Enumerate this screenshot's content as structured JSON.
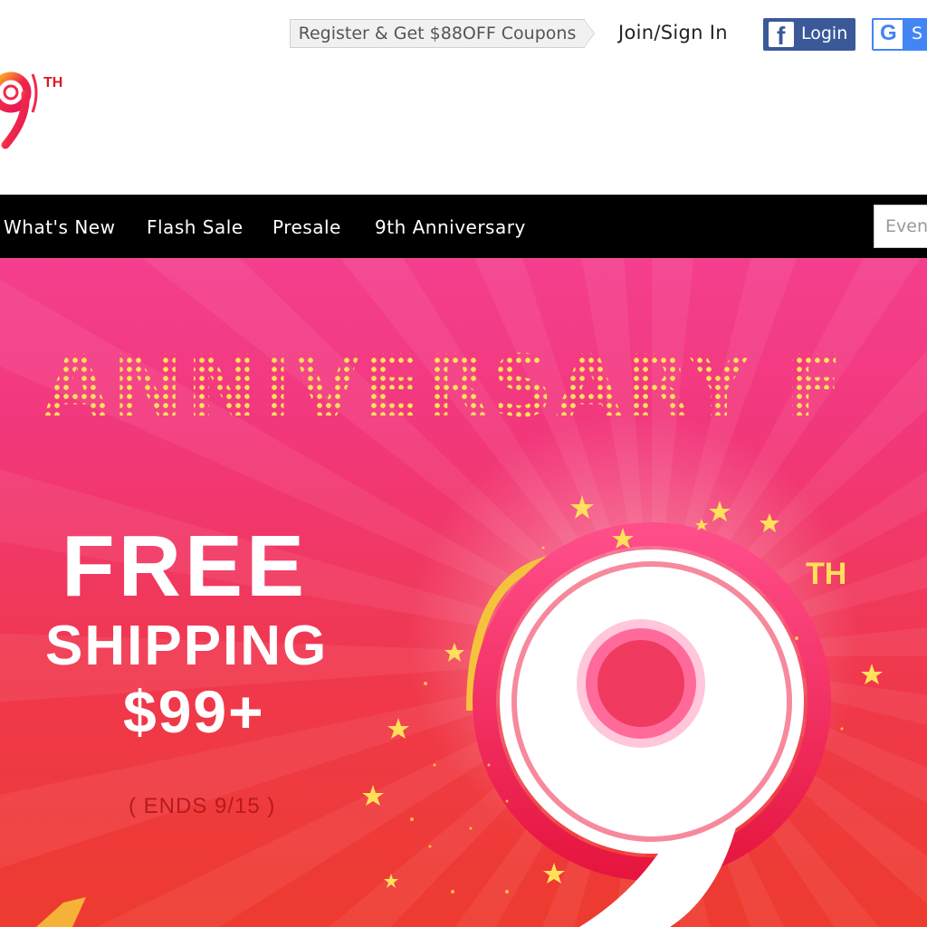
{
  "topbar": {
    "coupon_text": "Register & Get $88OFF Coupons",
    "join_text": "Join/Sign In",
    "facebook_label": "Login",
    "google_label": "S"
  },
  "logo": {
    "sup": "TH"
  },
  "nav": {
    "items": [
      "What's New",
      "Flash Sale",
      "Presale",
      "9th Anniversary"
    ],
    "search_placeholder": "Even"
  },
  "hero": {
    "headline": "ANNIVERSARY F",
    "free": "FREE",
    "shipping": "SHIPPING",
    "price": "$99+",
    "ends": "( ENDS 9/15 )",
    "big_number": "9",
    "big_sup": "TH"
  },
  "colors": {
    "nav_bg": "#000000",
    "facebook": "#3b5998",
    "google": "#4285f4",
    "hero_pink": "#f43f8e",
    "hero_red": "#ee3b2f",
    "accent_yellow": "#ffe05a"
  }
}
